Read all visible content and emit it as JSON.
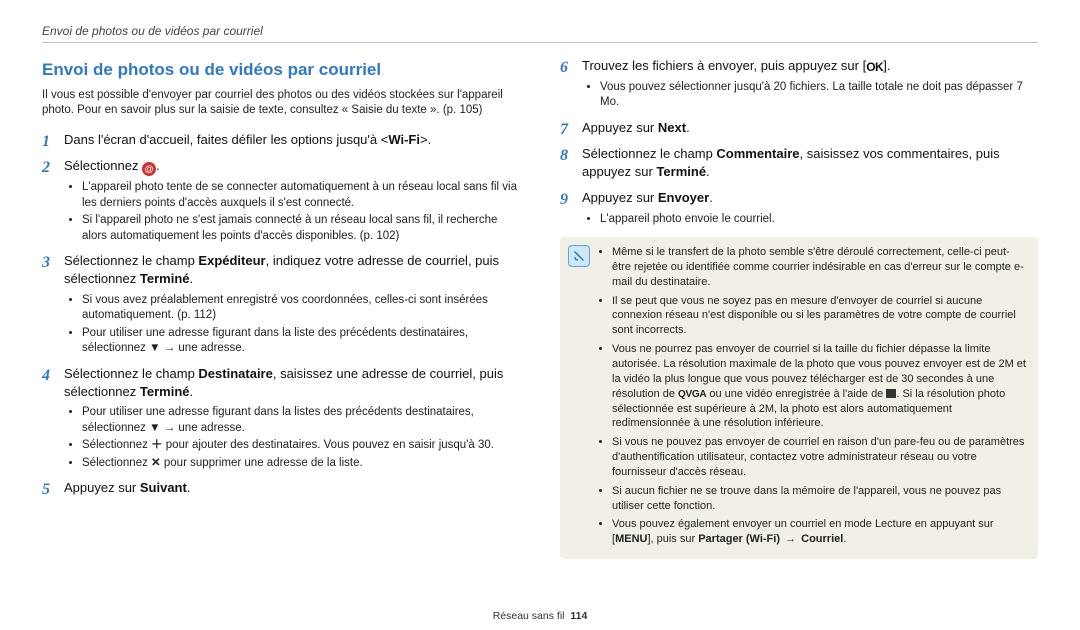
{
  "header": "Envoi de photos ou de vidéos par courriel",
  "title": "Envoi de photos ou de vidéos par courriel",
  "intro": "Il vous est possible d'envoyer par courriel des photos ou des vidéos stockées sur l'appareil photo. Pour en savoir plus sur la saisie de texte, consultez « Saisie du texte ».",
  "intro_ref": "(p. 105)",
  "left_steps": [
    {
      "main_pre": "Dans l'écran d'accueil, faites défiler les options jusqu'à <",
      "main_bold": "Wi-Fi",
      "main_post": ">.",
      "bullets": []
    },
    {
      "main_pre": "Sélectionnez ",
      "icon": "email",
      "main_post": ".",
      "bullets": [
        "L'appareil photo tente de se connecter automatiquement à un réseau local sans fil via les derniers points d'accès auxquels il s'est connecté.",
        "Si l'appareil photo ne s'est jamais connecté à un réseau local sans fil, il recherche alors automatiquement les points d'accès disponibles. (p. 102)"
      ]
    },
    {
      "main_pre": "Sélectionnez le champ ",
      "main_bold": "Expéditeur",
      "main_mid": ", indiquez votre adresse de courriel, puis sélectionnez ",
      "main_bold2": "Terminé",
      "main_post": ".",
      "bullets": [
        "Si vous avez préalablement enregistré vos coordonnées, celles-ci sont insérées automatiquement. (p. 112)",
        {
          "pre": "Pour utiliser une adresse figurant dans la liste des précédents destinataires, sélectionnez ",
          "icon": "down",
          "post": " → une adresse."
        }
      ]
    },
    {
      "main_pre": "Sélectionnez le champ ",
      "main_bold": "Destinataire",
      "main_mid": ", saisissez une adresse de courriel, puis sélectionnez ",
      "main_bold2": "Terminé",
      "main_post": ".",
      "bullets": [
        {
          "pre": "Pour utiliser une adresse figurant dans la listes des précédents destinataires, sélectionnez ",
          "icon": "down",
          "post": " → une adresse."
        },
        {
          "pre": "Sélectionnez ",
          "icon": "plus",
          "post": " pour ajouter des destinataires. Vous pouvez en saisir jusqu'à 30."
        },
        {
          "pre": "Sélectionnez ",
          "icon": "x",
          "post": " pour supprimer une adresse de la liste."
        }
      ]
    },
    {
      "main_pre": "Appuyez sur ",
      "main_bold": "Suivant",
      "main_post": ".",
      "bullets": []
    }
  ],
  "right_start": 6,
  "right_steps": [
    {
      "main_pre": "Trouvez les fichiers à envoyer, puis appuyez sur [",
      "ok": true,
      "main_post": "].",
      "bullets": [
        "Vous pouvez sélectionner jusqu'à 20 fichiers. La taille totale ne doit pas dépasser 7 Mo."
      ]
    },
    {
      "main_pre": "Appuyez sur ",
      "main_bold": "Next",
      "main_post": ".",
      "bullets": []
    },
    {
      "main_pre": "Sélectionnez le champ ",
      "main_bold": "Commentaire",
      "main_mid": ", saisissez vos commentaires, puis appuyez sur ",
      "main_bold2": "Terminé",
      "main_post": ".",
      "bullets": []
    },
    {
      "main_pre": "Appuyez sur ",
      "main_bold": "Envoyer",
      "main_post": ".",
      "bullets": [
        "L'appareil photo envoie le courriel."
      ]
    }
  ],
  "notes": [
    "Même si le transfert de la photo semble s'être déroulé correctement, celle-ci peut-être rejetée ou identifiée comme courrier indésirable en cas d'erreur sur le compte e-mail du destinataire.",
    "Il se peut que vous ne soyez pas en mesure d'envoyer de courriel si aucune connexion réseau n'est disponible ou si les paramètres de votre compte de courriel sont incorrects.",
    {
      "type": "complex",
      "pre": "Vous ne pourrez pas envoyer de courriel si la taille du fichier dépasse la limite autorisée. La résolution maximale de la photo que vous pouvez envoyer est de 2M et la vidéo la plus longue que vous pouvez télécharger est de 30 secondes à une résolution de ",
      "qvga": "QVGA",
      "mid": " ou une vidéo enregistrée à l'aide de ",
      "film": true,
      "post": ". Si la résolution photo sélectionnée est supérieure à 2M, la photo est alors automatiquement redimensionnée à une résolution inférieure."
    },
    "Si vous ne pouvez pas envoyer de courriel en raison d'un pare-feu ou de paramètres d'authentification utilisateur, contactez votre administrateur réseau ou votre fournisseur d'accès réseau.",
    "Si aucun fichier ne se trouve dans la mémoire de l'appareil, vous ne pouvez pas utiliser cette fonction.",
    {
      "type": "menu",
      "pre": "Vous pouvez également envoyer un courriel en mode Lecture en appuyant sur [",
      "menu": "MENU",
      "mid": "], puis sur ",
      "bold": "Partager (Wi-Fi)",
      "arrow": " → ",
      "bold2": "Courriel",
      "post": "."
    }
  ],
  "footer_label": "Réseau sans fil",
  "footer_page": "114"
}
